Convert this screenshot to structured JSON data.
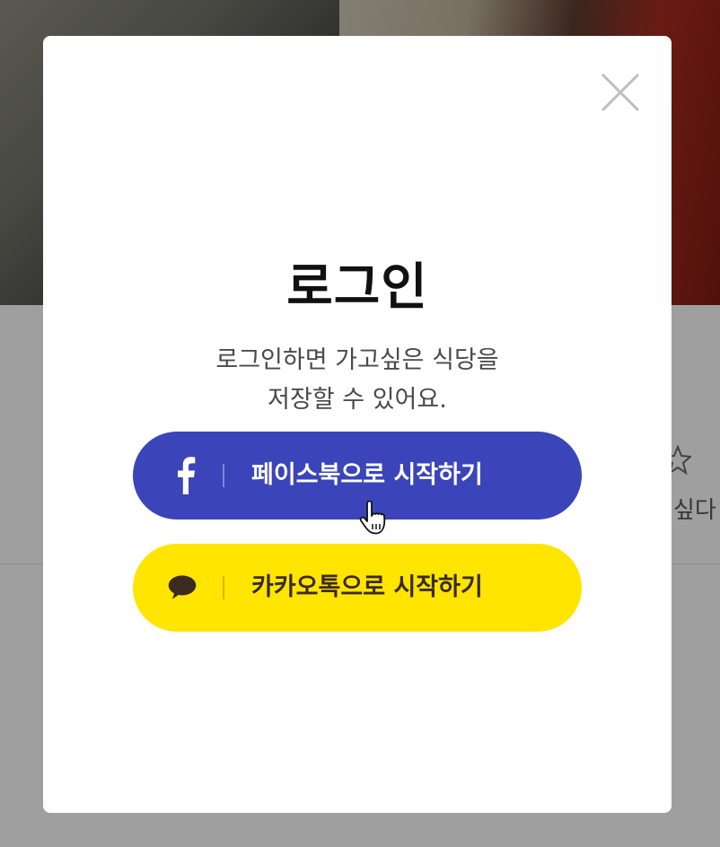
{
  "modal": {
    "title": "로그인",
    "description_lines": [
      "로그인하면 가고싶은 식당을",
      "저장할 수 있어요."
    ],
    "close_icon": "close-icon"
  },
  "buttons": {
    "facebook": {
      "label": "페이스북으로 시작하기",
      "icon": "facebook-icon",
      "color": "#3b45b9"
    },
    "kakao": {
      "label": "카카오톡으로 시작하기",
      "icon": "kakaotalk-icon",
      "color": "#ffe500"
    }
  },
  "background": {
    "side_text": "싶다",
    "side_icon": "star-icon"
  }
}
